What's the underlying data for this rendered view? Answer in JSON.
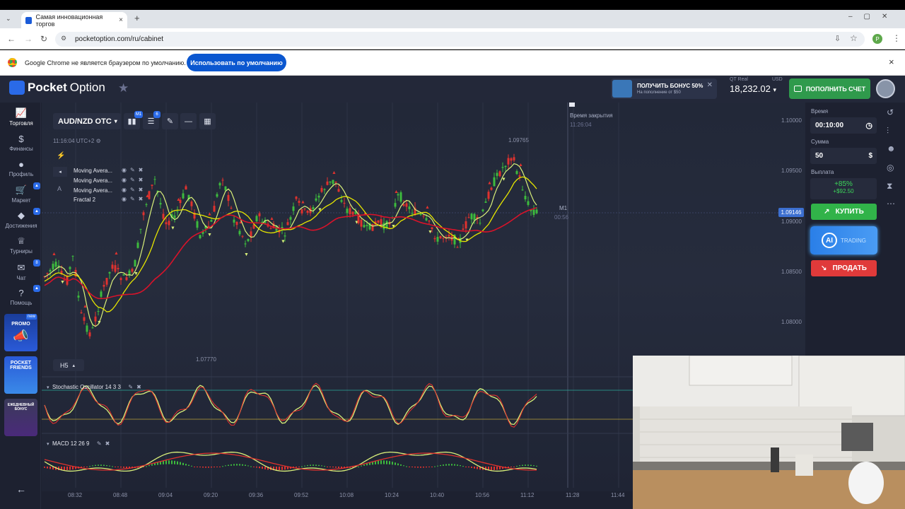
{
  "browser": {
    "tab_title": "Самая инновационная торгов",
    "tab_close": "×",
    "new_tab": "+",
    "url": "pocketoption.com/ru/cabinet",
    "profile_initial": "P",
    "infobar_text": "Google Chrome не является браузером по умолчанию.",
    "infobar_button": "Использовать по умолчанию",
    "infobar_close": "×"
  },
  "header": {
    "logo_bold": "Pocket",
    "logo_rest": "Option",
    "bonus_title": "ПОЛУЧИТЬ БОНУС 50%",
    "bonus_sub": "На пополнение от $50",
    "account_type": "QT Real",
    "currency": "USD",
    "balance": "18,232.02",
    "topup_label": "ПОПОЛНИТЬ СЧЕТ"
  },
  "sidebar": {
    "items": [
      {
        "label": "Торговля"
      },
      {
        "label": "Финансы"
      },
      {
        "label": "Профиль"
      },
      {
        "label": "Маркет"
      },
      {
        "label": "Достижения"
      },
      {
        "label": "Турниры"
      },
      {
        "label": "Чат",
        "badge": "8"
      },
      {
        "label": "Помощь"
      }
    ],
    "promo": {
      "new_badge": "new",
      "label": "PROMO"
    },
    "friends": "POCKET FRIENDS",
    "daily": "ЕЖЕДНЕВНЫЙ БОНУС"
  },
  "chart": {
    "pair": "AUD/NZD OTC",
    "tf_badge": "M1",
    "ind_badge": "6",
    "time": "11:16:04 UTC+2",
    "indicators": [
      "Moving Avera...",
      "Moving Avera...",
      "Moving Avera...",
      "Fractal 2"
    ],
    "close_time_label": "Время закрытия",
    "close_time_value": "11:26:04",
    "timer_tf": "M1",
    "timer_value": "00:56",
    "high_label": "1.09765",
    "low_label": "1.07770",
    "current_price": "1.09146",
    "y_ticks": [
      "1.10000",
      "1.09500",
      "1.09000",
      "1.08500",
      "1.08000"
    ],
    "x_ticks": [
      "08:32",
      "08:48",
      "09:04",
      "09:20",
      "09:36",
      "09:52",
      "10:08",
      "10:24",
      "10:40",
      "10:56",
      "11:12",
      "11:28",
      "11:44"
    ],
    "period": "H5",
    "stoch_title": "Stochastic Oscillator  14 3 3",
    "macd_title": "MACD  12 26 9",
    "colors": {
      "up": "#3dbb3d",
      "down": "#e0322e",
      "ma_yellow": "#e6e600",
      "ma_light": "#d9f07a",
      "ma_red": "#d8132a"
    }
  },
  "right_panel": {
    "time_label": "Время",
    "time_value": "00:10:00",
    "amount_label": "Сумма",
    "amount_value": "50",
    "payout_label": "Выплата",
    "payout_pct": "+85%",
    "payout_amount": "+$92.50",
    "buy_label": "КУПИТЬ",
    "ai_label": "AI",
    "ai_sub": "TRADING",
    "sell_label": "ПРОДАТЬ"
  }
}
